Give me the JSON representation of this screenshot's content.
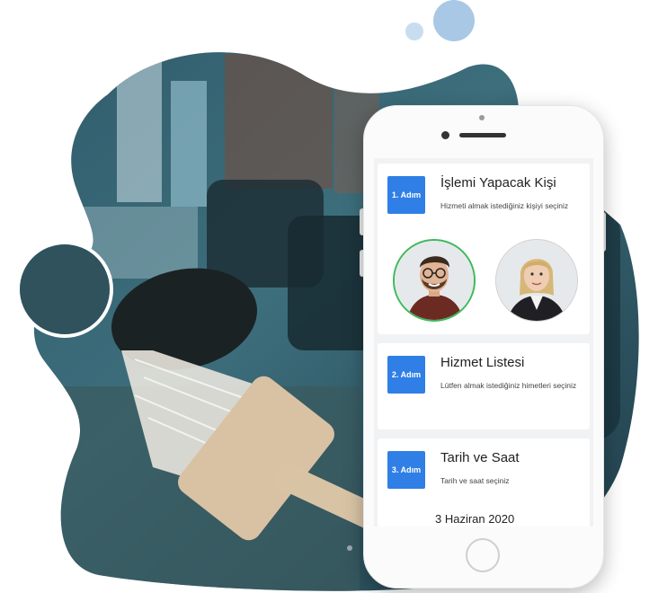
{
  "colors": {
    "accent": "#2f7fe6",
    "selected_border": "#3cb95a",
    "bubble": "#a9c8e6",
    "screen_bg": "#f1f2f4"
  },
  "steps": [
    {
      "badge": "1. Adım",
      "title": "İşlemi Yapacak Kişi",
      "subtitle": "Hizmeti almak istediğiniz kişiyi seçiniz"
    },
    {
      "badge": "2. Adım",
      "title": "Hizmet Listesi",
      "subtitle": "Lütfen almak istediğiniz himetleri seçiniz"
    },
    {
      "badge": "3. Adım",
      "title": "Tarih ve Saat",
      "subtitle": "Tarih ve saat seçiniz",
      "date": "3 Haziran 2020"
    }
  ],
  "staff": [
    {
      "icon": "male-barber-avatar",
      "selected": true
    },
    {
      "icon": "female-barber-avatar",
      "selected": false
    }
  ]
}
